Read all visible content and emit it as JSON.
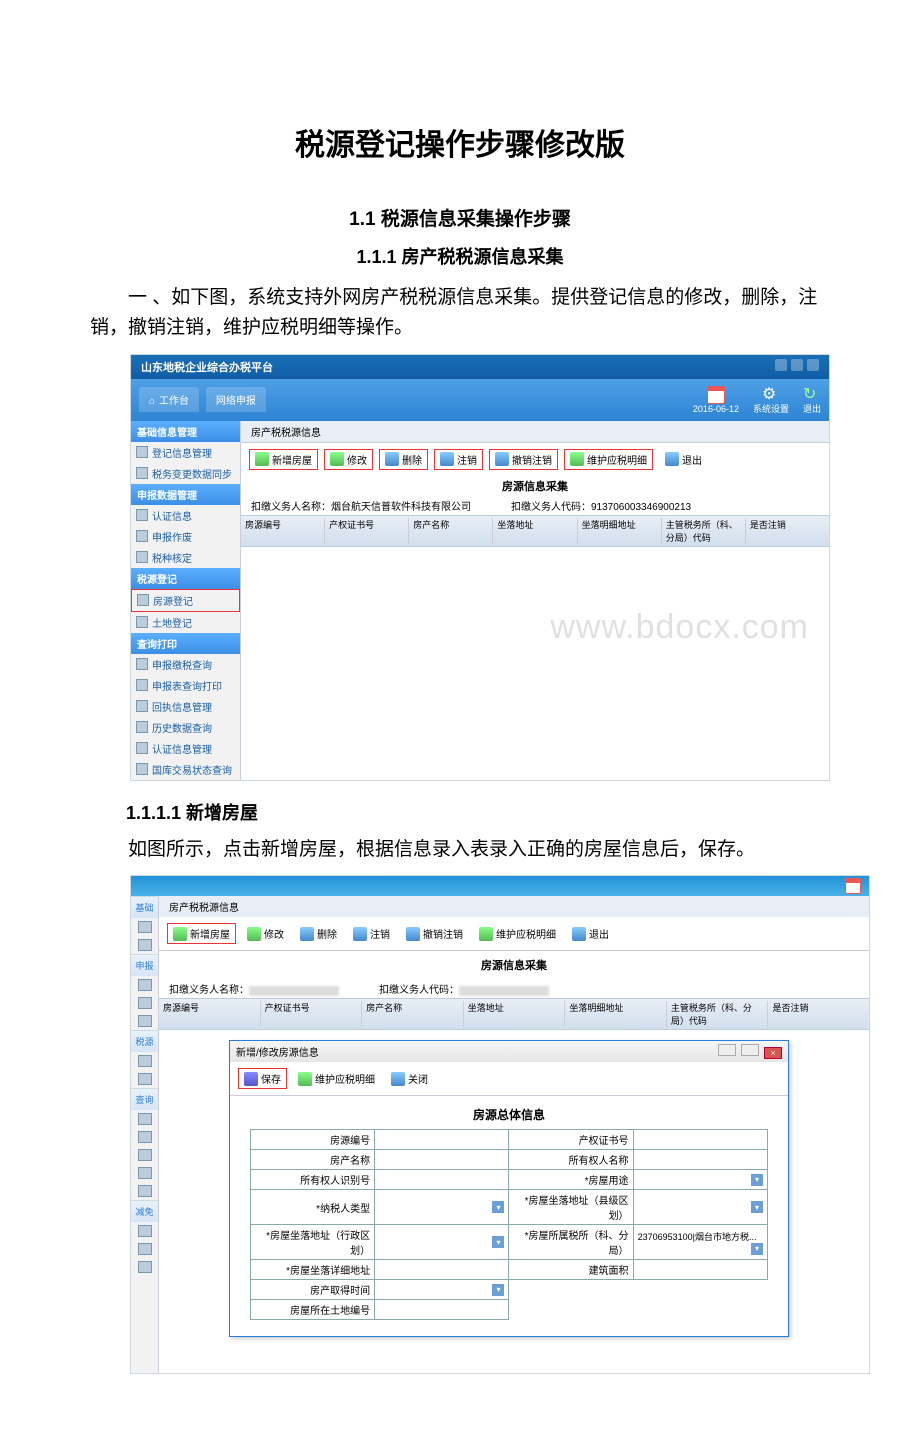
{
  "doc": {
    "title": "税源登记操作步骤修改版",
    "section1": "1.1 税源信息采集操作步骤",
    "section11": "1.1.1 房产税税源信息采集",
    "para1": "一 、如下图，系统支持外网房产税税源信息采集。提供登记信息的修改，删除，注销，撤销注销，维护应税明细等操作。",
    "section1111": "1.1.1.1 新增房屋",
    "para2": "如图所示，点击新增房屋，根据信息录入表录入正确的房屋信息后，保存。"
  },
  "s1": {
    "app_title": "山东地税企业综合办税平台",
    "menu_home": "工作台",
    "menu_item1": "网络申报",
    "header_date": "2016-06-12",
    "header_settings": "系统设置",
    "header_exit": "退出",
    "tab": "房产税税源信息",
    "toolbar": {
      "add": "新增房屋",
      "edit": "修改",
      "del": "删除",
      "cancel": "注销",
      "undo": "撤销注销",
      "maint": "维护应税明细",
      "exit": "退出"
    },
    "content_title": "房源信息采集",
    "payer_name_label": "扣缴义务人名称：",
    "payer_name_value": "烟台航天信普软件科技有限公司",
    "payer_code_label": "扣缴义务人代码：",
    "payer_code_value": "913706003346900213",
    "table": {
      "c1": "房源编号",
      "c2": "产权证书号",
      "c3": "房产名称",
      "c4": "坐落地址",
      "c5": "坐落明细地址",
      "c6": "主管税务所（科、分局）代码",
      "c7": "是否注销"
    },
    "sidebar": {
      "g1": "基础信息管理",
      "g1_i1": "登记信息管理",
      "g1_i2": "税务变更数据同步",
      "g2": "申报数据管理",
      "g2_i1": "认证信息",
      "g2_i2": "申报作废",
      "g2_i3": "税种核定",
      "g3": "税源登记",
      "g3_i1": "房源登记",
      "g3_i2": "土地登记",
      "g4": "查询打印",
      "g4_i1": "申报缴税查询",
      "g4_i2": "申报表查询打印",
      "g4_i3": "回执信息管理",
      "g4_i4": "历史数据查询",
      "g4_i5": "认证信息管理",
      "g4_i6": "国库交易状态查询"
    },
    "watermark": "www.bdocx.com"
  },
  "s2": {
    "tab": "房产税税源信息",
    "toolbar": {
      "add": "新增房屋",
      "edit": "修改",
      "del": "删除",
      "cancel": "注销",
      "undo": "撤销注销",
      "maint": "维护应税明细",
      "exit": "退出"
    },
    "content_title": "房源信息采集",
    "payer_name_label": "扣缴义务人名称：",
    "payer_code_label": "扣缴义务人代码：",
    "table": {
      "c1": "房源编号",
      "c2": "产权证书号",
      "c3": "房产名称",
      "c4": "坐落地址",
      "c5": "坐落明细地址",
      "c6": "主管税务所（科、分局）代码",
      "c7": "是否注销"
    },
    "side": {
      "s1": "基础",
      "s2": "申报",
      "s3": "税源",
      "s4": "查询",
      "s5": "减免"
    },
    "dialog": {
      "title": "新增/修改房源信息",
      "save": "保存",
      "maint": "维护应税明细",
      "close": "关闭",
      "heading": "房源总体信息",
      "fields": {
        "f1": "房源编号",
        "f2": "产权证书号",
        "f3": "房产名称",
        "f4": "所有权人名称",
        "f5": "所有权人识别号",
        "f6": "*房屋用途",
        "f7": "*纳税人类型",
        "f8": "*房屋坐落地址（县级区划）",
        "f9": "*房屋坐落地址（行政区划）",
        "f10": "*房屋坐落详细地址",
        "f11": "*房屋所属税所（科、分局）",
        "f11_val": "23706953100|烟台市地方税...",
        "f12": "房产取得时间",
        "f13": "建筑面积",
        "f14": "房屋所在土地编号"
      }
    }
  }
}
